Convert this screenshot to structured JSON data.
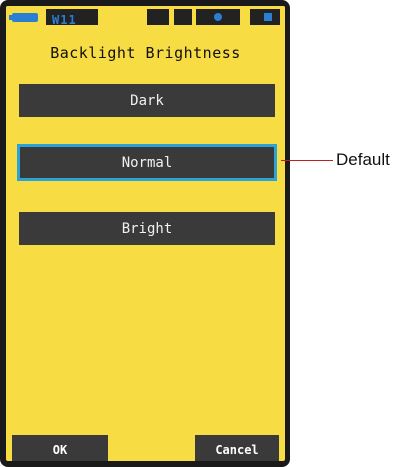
{
  "status_bar": {
    "mode_text": "W11",
    "icon_color": "#2b7fd3"
  },
  "screen": {
    "title": "Backlight Brightness",
    "background_color": "#f7dc43",
    "options": [
      {
        "label": "Dark",
        "selected": false
      },
      {
        "label": "Normal",
        "selected": true
      },
      {
        "label": "Bright",
        "selected": false
      }
    ],
    "selection_color": "#2aa3d8"
  },
  "footer": {
    "ok_label": "OK",
    "cancel_label": "Cancel"
  },
  "annotation": {
    "label": "Default",
    "line_color": "#b22222"
  }
}
